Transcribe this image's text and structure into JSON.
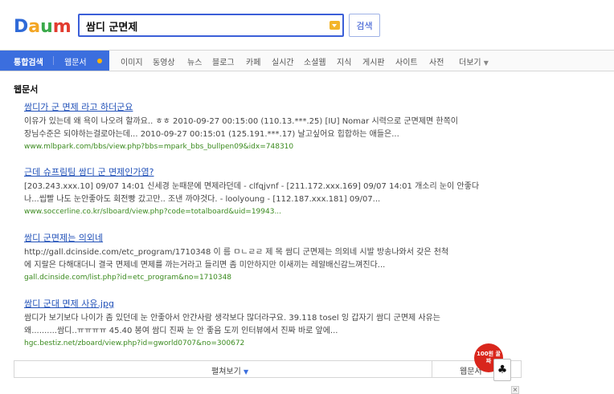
{
  "colors": {
    "accent": "#3b6ede",
    "link": "#2050b8",
    "url": "#3a8a1e"
  },
  "logo": {
    "text": "Daum"
  },
  "search": {
    "value": "쌈디 군면제",
    "button": "검색"
  },
  "nav": {
    "tabs": [
      "통합검색",
      "웹문서",
      "이미지",
      "동영상",
      "뉴스",
      "블로그",
      "카페",
      "실시간",
      "소셜웹",
      "지식",
      "게시판",
      "사이트",
      "사전",
      "더보기"
    ]
  },
  "section": {
    "title": "웹문서"
  },
  "results": [
    {
      "title": "쌈디가 군 면제 라고 하더군요",
      "desc1": "이유가 있는데 왜 욕이 나오려 할까요.. ㅎㅎ 2010-09-27 00:15:00 (110.13.***.25) [IU] Nomar 시력으로 군면제면 한쪽이",
      "desc2": "장님수준은 되야하는걸로아는데... 2010-09-27 00:15:01 (125.191.***.17) 날고싶어요 힙합하는 애들은...",
      "url": "www.mlbpark.com/bbs/view.php?bbs=mpark_bbs_bullpen09&idx=748310"
    },
    {
      "title": "근데 슈프림팀 쌈디 군 면제인가염?",
      "desc1": "[203.243.xxx.10] 09/07 14:01 신세경 눈때문에 면제라던데 - clfqjvnf - [211.172.xxx.169] 09/07 14:01 개소리 눈이 안좋다",
      "desc2": "나...씹빨 나도 눈안좋아도 회전빵 갔고만.. 조낸 까야것다. - loolyoung - [112.187.xxx.181] 09/07...",
      "url": "www.soccerline.co.kr/slboard/view.php?code=totalboard&uid=19943..."
    },
    {
      "title": "쌈디 군면제는 의외네",
      "desc1": "http://gall.dcinside.com/etc_program/1710348 이 름 ㅁㄴㄹㄹ 제 목 쌈디 군면제는 의외네 시발 방송나와서 갖은 천척",
      "desc2": "에 지랄은 다해대더니 결국 면제네 면제를 까는거라고 들리면 좀 미안하지만 이새끼는 레알배신감느껴진다...",
      "url": "gall.dcinside.com/list.php?id=etc_program&no=1710348"
    },
    {
      "title": "쌈디 군대 면제 사유.jpg",
      "desc1": "쌈디가 보기보다 나이가 좀 있던데 눈 안좋아서 안간사람 생각보다 많더라구요. 39.118 tosel 잉 갑자기 쌈디 군면제 사유는",
      "desc2": "왜..........쌈디..ㅠㅠㅠㅠ 45.40 봉여 쌈디 진짜 눈 안 좋음 도끼 인터뷰에서 진짜 바로 앞에...",
      "url": "hgc.bestiz.net/zboard/view.php?id=gworld0707&no=300672"
    }
  ],
  "more": {
    "label": "펼쳐보기",
    "right_label": "웹문서"
  },
  "ad": {
    "badge": "100원 꿀짜",
    "close": "×"
  }
}
